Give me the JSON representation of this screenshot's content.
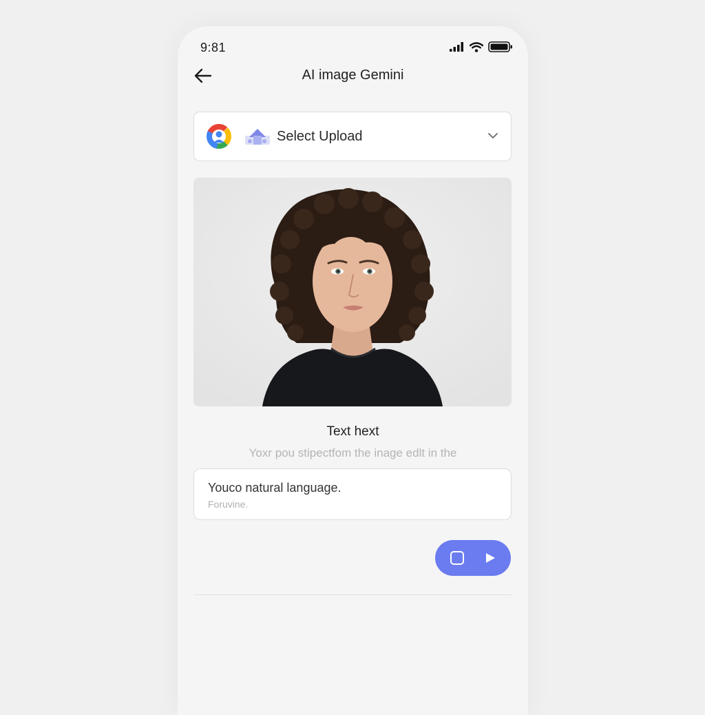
{
  "status_bar": {
    "time": "9:81"
  },
  "header": {
    "title": "AI image Gemini"
  },
  "select": {
    "label": "Select Upload"
  },
  "section": {
    "title": "Text hext",
    "subtitle": "Yoxr pou stipectfom the inage edlt in the"
  },
  "prompt": {
    "value": "Youco natural language.",
    "placeholder": "Foruvine."
  },
  "colors": {
    "accent": "#6b7cf0",
    "background": "#f5f5f5"
  },
  "icons": {
    "back": "back-arrow-icon",
    "google": "google-logo-icon",
    "upload": "image-upload-icon",
    "chevron": "chevron-down-icon",
    "stop": "square-icon",
    "play": "play-icon"
  }
}
